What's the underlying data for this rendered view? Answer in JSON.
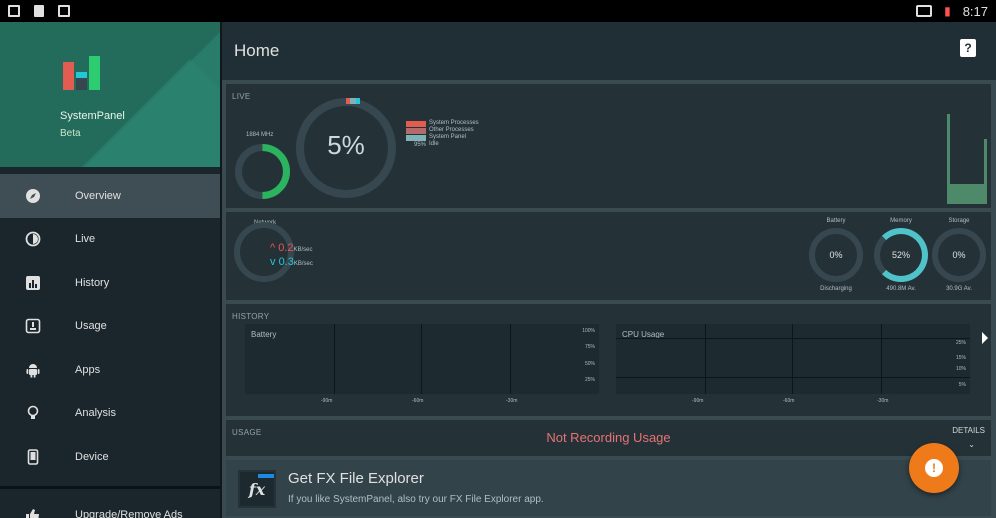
{
  "statusbar": {
    "time": "8:17"
  },
  "sidebar": {
    "app_name": "SystemPanel",
    "app_sub": "Beta",
    "items": [
      {
        "label": "Overview",
        "icon": "compass-icon"
      },
      {
        "label": "Live",
        "icon": "clock-icon"
      },
      {
        "label": "History",
        "icon": "bar-chart-icon"
      },
      {
        "label": "Usage",
        "icon": "gauge-icon"
      },
      {
        "label": "Apps",
        "icon": "android-icon"
      },
      {
        "label": "Analysis",
        "icon": "lightbulb-icon"
      },
      {
        "label": "Device",
        "icon": "phone-icon"
      }
    ],
    "upgrade_label": "Upgrade/Remove Ads"
  },
  "header": {
    "title": "Home"
  },
  "live": {
    "label": "LIVE",
    "freq": "1884 MHz",
    "cpu_percent": "5%",
    "legend": [
      "System Processes",
      "Other Processes",
      "System Panel",
      "Idle"
    ],
    "legend_idle_pct": "95%",
    "colors": {
      "system": "#e25c52",
      "other": "#7fb3b8",
      "panel": "#26c6da",
      "idle": "#546e7a"
    }
  },
  "network": {
    "label": "Network",
    "up": "0.2",
    "down": "0.3",
    "unit": "KB/sec",
    "battery": {
      "title": "Battery",
      "value": "0%",
      "sub": "Discharging"
    },
    "memory": {
      "title": "Memory",
      "value": "52%",
      "sub": "490.8M Av."
    },
    "storage": {
      "title": "Storage",
      "value": "0%",
      "sub": "30.9G Av."
    }
  },
  "history": {
    "label": "HISTORY",
    "battery_title": "Battery",
    "cpu_title": "CPU Usage",
    "battery_yticks": [
      "100%",
      "75%",
      "50%",
      "25%"
    ],
    "cpu_yticks": [
      "25%",
      "15%",
      "10%",
      "5%"
    ],
    "xticks": [
      "-90m",
      "-60m",
      "-30m"
    ]
  },
  "usage": {
    "label": "USAGE",
    "status": "Not Recording Usage",
    "details": "DETAILS"
  },
  "promo": {
    "logo": "fx",
    "title": "Get FX File Explorer",
    "text": "If you like SystemPanel, also try our FX File Explorer app."
  },
  "fab": {
    "icon": "alert-icon",
    "glyph": "!"
  }
}
